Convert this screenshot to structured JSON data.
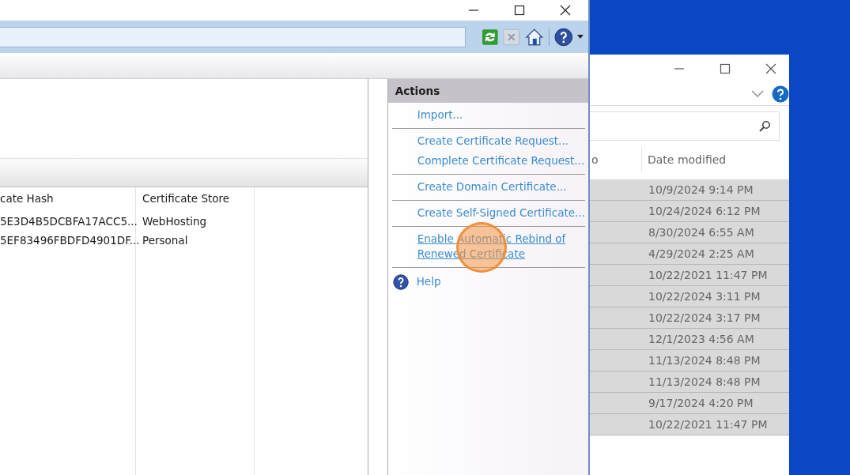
{
  "iis_window": {
    "certificates_table": {
      "columns": [
        "cate Hash",
        "Certificate Store"
      ],
      "rows": [
        {
          "hash": "5E3D4B5DCBFA17ACC5...",
          "store": "WebHosting"
        },
        {
          "hash": "5EF83496FBDFD4901DF...",
          "store": "Personal"
        }
      ]
    },
    "actions": {
      "title": "Actions",
      "groups": [
        [
          {
            "label": "Import...",
            "hovered": false
          }
        ],
        [
          {
            "label": "Create Certificate Request...",
            "hovered": false
          },
          {
            "label": "Complete Certificate Request...",
            "hovered": false
          }
        ],
        [
          {
            "label": "Create Domain Certificate...",
            "hovered": false
          }
        ],
        [
          {
            "label": "Create Self-Signed Certificate...",
            "hovered": false
          }
        ],
        [
          {
            "label": "Enable Automatic Rebind of Renewed Certificate",
            "hovered": true
          }
        ]
      ],
      "help": "Help"
    }
  },
  "explorer_window": {
    "columns": [
      "o",
      "Date modified"
    ],
    "rows": [
      {
        "date": "10/9/2024 9:14 PM",
        "selected": true
      },
      {
        "date": "10/24/2024 6:12 PM",
        "selected": true
      },
      {
        "date": "8/30/2024 6:55 AM",
        "selected": true
      },
      {
        "date": "4/29/2024 2:25 AM",
        "selected": true
      },
      {
        "date": "10/22/2021 11:47 PM",
        "selected": true
      },
      {
        "date": "10/22/2024 3:11 PM",
        "selected": true
      },
      {
        "date": "10/22/2024 3:17 PM",
        "selected": true
      },
      {
        "date": "12/1/2023 4:56 AM",
        "selected": true
      },
      {
        "date": "11/13/2024 8:48 PM",
        "selected": true
      },
      {
        "date": "11/13/2024 8:48 PM",
        "selected": true
      },
      {
        "date": "9/17/2024 4:20 PM",
        "selected": true
      },
      {
        "date": "10/22/2021 11:47 PM",
        "selected": true
      }
    ]
  }
}
